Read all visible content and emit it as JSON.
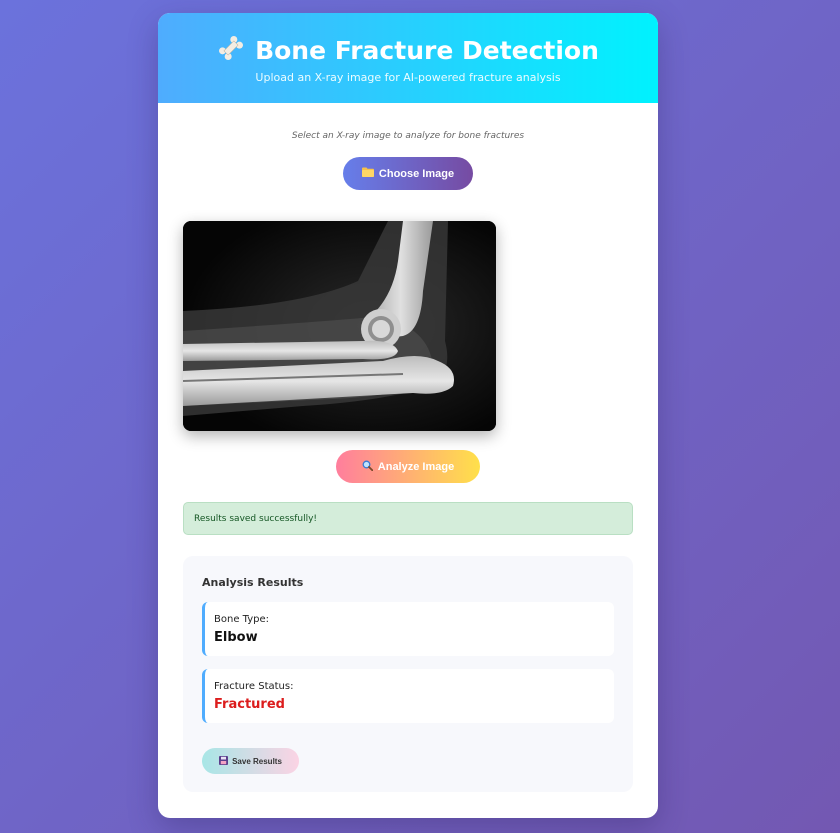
{
  "header": {
    "icon": "bone-icon",
    "title": "Bone Fracture Detection",
    "subtitle": "Upload an X-ray image for AI-powered fracture analysis"
  },
  "upload": {
    "hint": "Select an X-ray image to analyze for bone fractures",
    "choose_label": "Choose Image",
    "choose_icon": "folder-icon"
  },
  "preview": {
    "image_subject": "elbow-xray"
  },
  "analyze": {
    "label": "Analyze Image",
    "icon": "magnifier-icon"
  },
  "status": {
    "message": "Results saved successfully!"
  },
  "results": {
    "title": "Analysis Results",
    "items": [
      {
        "label": "Bone Type:",
        "value": "Elbow"
      },
      {
        "label": "Fracture Status:",
        "value": "Fractured",
        "color": "#dc1d1d"
      }
    ],
    "save_label": "Save Results",
    "save_icon": "floppy-disk-icon"
  },
  "colors": {
    "header_gradient": [
      "#4facfe",
      "#00f2fe"
    ],
    "primary_button": [
      "#667eea",
      "#764ba2"
    ],
    "analyze_button": [
      "#ff7e9d",
      "#ffe04a"
    ],
    "success_bg": "#d4edda",
    "danger": "#dc1d1d"
  }
}
